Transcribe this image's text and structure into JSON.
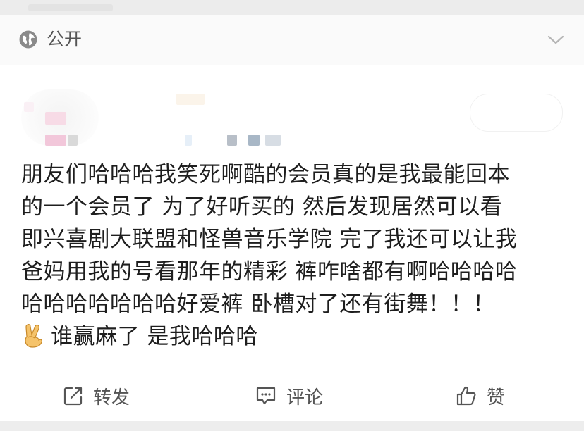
{
  "header": {
    "visibility_label": "公开",
    "visibility_icon": "globe-icon",
    "expand_icon": "chevron-down-icon"
  },
  "post": {
    "lines": [
      "朋友们哈哈哈我笑死啊酷的会员真的是我最能回本",
      "的一个会员了 为了好听买的 然后发现居然可以看",
      "即兴喜剧大联盟和怪兽音乐学院 完了我还可以让我",
      "爸妈用我的号看那年的精彩 裤咋啥都有啊哈哈哈哈",
      "哈哈哈哈哈哈哈好爱裤 卧槽对了还有街舞！！！"
    ],
    "last_line": "谁赢麻了 是我哈哈哈",
    "last_line_icon": "victory-hand-emoji-icon"
  },
  "actions": {
    "repost_label": "转发",
    "comment_label": "评论",
    "like_label": "赞"
  },
  "colors": {
    "text": "#1e1e1e",
    "muted": "#555555",
    "background": "#f2f2f2",
    "card": "#ffffff"
  }
}
